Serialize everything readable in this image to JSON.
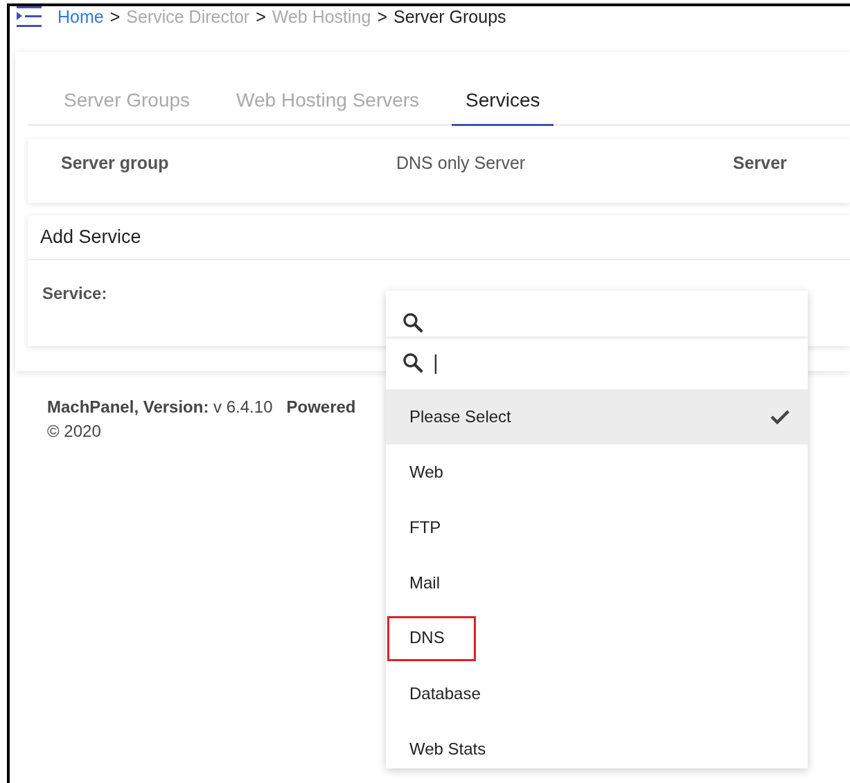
{
  "breadcrumb": [
    {
      "label": "Home",
      "kind": "link"
    },
    {
      "label": "Service Director",
      "kind": "muted"
    },
    {
      "label": "Web Hosting",
      "kind": "muted"
    },
    {
      "label": "Server Groups",
      "kind": "current"
    }
  ],
  "breadcrumb_separator": ">",
  "tabs": [
    {
      "label": "Server Groups",
      "selected": false
    },
    {
      "label": "Web Hosting Servers",
      "selected": false
    },
    {
      "label": "Services",
      "selected": true
    }
  ],
  "info_row": [
    {
      "label": "Server group",
      "bold": true
    },
    {
      "label": "DNS only Server",
      "bold": false
    },
    {
      "label": "Server",
      "bold": true
    }
  ],
  "add_service": {
    "title": "Add Service",
    "field_label": "Service:"
  },
  "footer": {
    "version_label": "MachPanel, Version:",
    "version": "v 6.4.10",
    "powered": "Powered",
    "copyright": "© 2020"
  },
  "dropdown": {
    "cursor": "|",
    "options": [
      {
        "label": "Please Select",
        "selected": true,
        "highlighted": false
      },
      {
        "label": "Web",
        "selected": false,
        "highlighted": false
      },
      {
        "label": "FTP",
        "selected": false,
        "highlighted": false
      },
      {
        "label": "Mail",
        "selected": false,
        "highlighted": false
      },
      {
        "label": "DNS",
        "selected": false,
        "highlighted": true
      },
      {
        "label": "Database",
        "selected": false,
        "highlighted": false
      },
      {
        "label": "Web Stats",
        "selected": false,
        "highlighted": false
      }
    ]
  }
}
